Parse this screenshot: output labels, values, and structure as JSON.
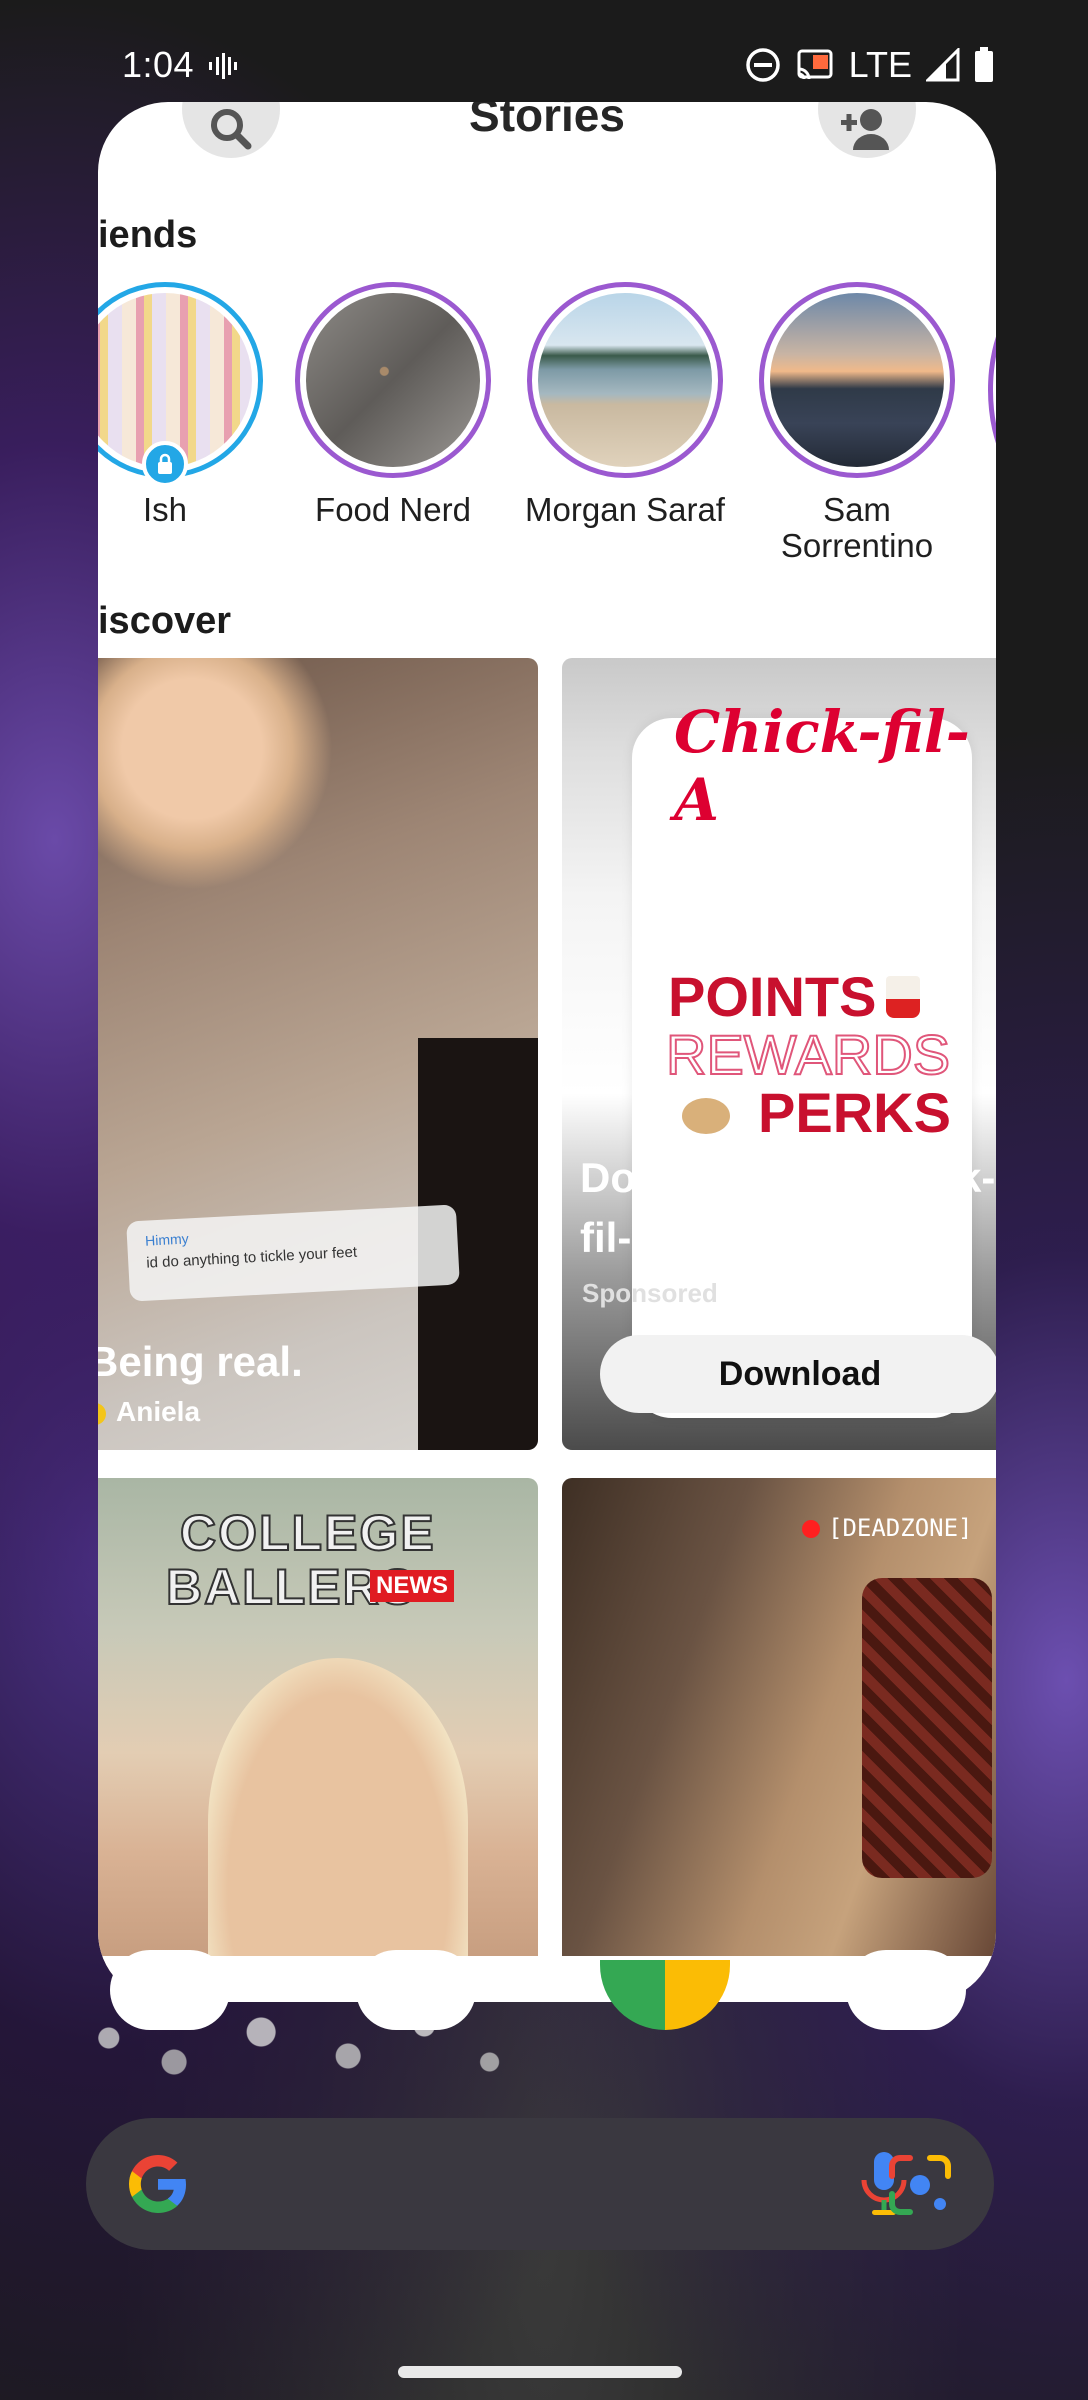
{
  "status_bar": {
    "time": "1:04",
    "network": "LTE"
  },
  "header": {
    "title": "Stories"
  },
  "friends": {
    "section_title": "iends",
    "items": [
      {
        "name": "Ish"
      },
      {
        "name": "Food Nerd"
      },
      {
        "name": "Morgan Saraf"
      },
      {
        "name": "Sam Sorrentino"
      }
    ]
  },
  "discover": {
    "section_title": "iscover",
    "tiles": [
      {
        "title": "Being real.",
        "author": "Aniela",
        "comment_name": "Himmy",
        "comment_text": "id do anything to tickle your feet"
      },
      {
        "brand": "Chick-fil-A",
        "promo_line1": "POINTS",
        "promo_line2": "REWARDS",
        "promo_line3": "PERKS",
        "title": "Download the Chick-fil-A® App",
        "label": "Sponsored",
        "button_label": "Download"
      },
      {
        "logo_line1": "COLLEGE",
        "logo_line2": "BALLERS",
        "logo_badge": "NEWS"
      },
      {
        "channel_tag": "[DEADZONE]"
      }
    ]
  },
  "colors": {
    "story_ring": "#9b59d0",
    "story_ring_private": "#23a7e6",
    "chickfila_red": "#dd0031"
  }
}
